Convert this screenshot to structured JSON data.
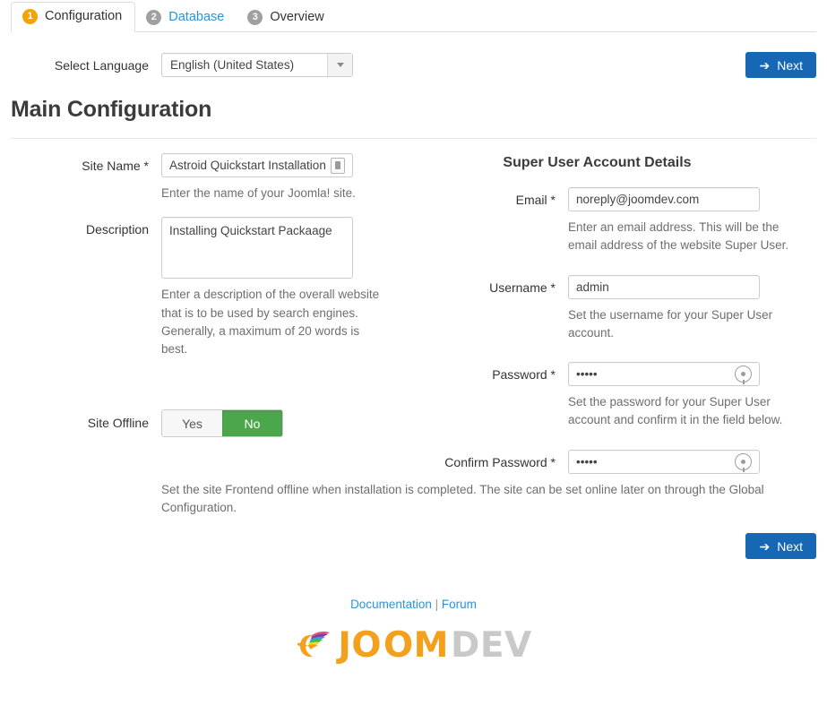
{
  "tabs": [
    {
      "number": "1",
      "label": "Configuration",
      "state": "active"
    },
    {
      "number": "2",
      "label": "Database",
      "state": "link"
    },
    {
      "number": "3",
      "label": "Overview",
      "state": "plain"
    }
  ],
  "language": {
    "label": "Select Language",
    "selected": "English (United States)",
    "options": [
      "English (United States)"
    ]
  },
  "buttons": {
    "next_label": "Next",
    "next_arrow": "➔"
  },
  "page": {
    "title": "Main Configuration"
  },
  "left_column": {
    "site_name": {
      "label": "Site Name *",
      "value": "Astroid Quickstart Installation",
      "placeholder": "",
      "help": "Enter the name of your Joomla! site.",
      "icon": "chrome-autofill-icon"
    },
    "description": {
      "label": "Description",
      "value": "Installing Quickstart Packaage",
      "placeholder": "",
      "help": "Enter a description of the overall website that is to be used by search engines. Generally, a maximum of 20 words is best."
    },
    "site_offline": {
      "label": "Site Offline",
      "options": [
        "Yes",
        "No"
      ],
      "selected": "No",
      "help": "Set the site Frontend offline when installation is completed. The site can be set online later on through the Global Configuration."
    }
  },
  "right_column": {
    "section_title": "Super User Account Details",
    "email": {
      "label": "Email *",
      "value": "noreply@joomdev.com",
      "placeholder": "",
      "help": "Enter an email address. This will be the email address of the website Super User."
    },
    "username": {
      "label": "Username *",
      "value": "admin",
      "placeholder": "",
      "help": "Set the username for your Super User account."
    },
    "password": {
      "label": "Password *",
      "value": "•••••",
      "placeholder": "",
      "help": "Set the password for your Super User account and confirm it in the field below.",
      "icon": "password-key-icon"
    },
    "confirm_password": {
      "label": "Confirm Password *",
      "value": "•••••",
      "placeholder": "",
      "icon": "password-key-icon"
    }
  },
  "footer": {
    "documentation": "Documentation",
    "separator": "|",
    "forum": "Forum",
    "logo": {
      "part1": "JO",
      "part2": "OM",
      "part3": "DEV",
      "icon": "joomdev-hummingbird-logo"
    }
  },
  "colors": {
    "accent_blue": "#1667b4",
    "link_blue": "#2a93d5",
    "badge_active": "#f5a302",
    "badge_idle": "#a0a0a0",
    "toggle_on_green": "#4ca64c",
    "logo_orange": "#f3a01c",
    "logo_grey": "#c9c9c9"
  }
}
